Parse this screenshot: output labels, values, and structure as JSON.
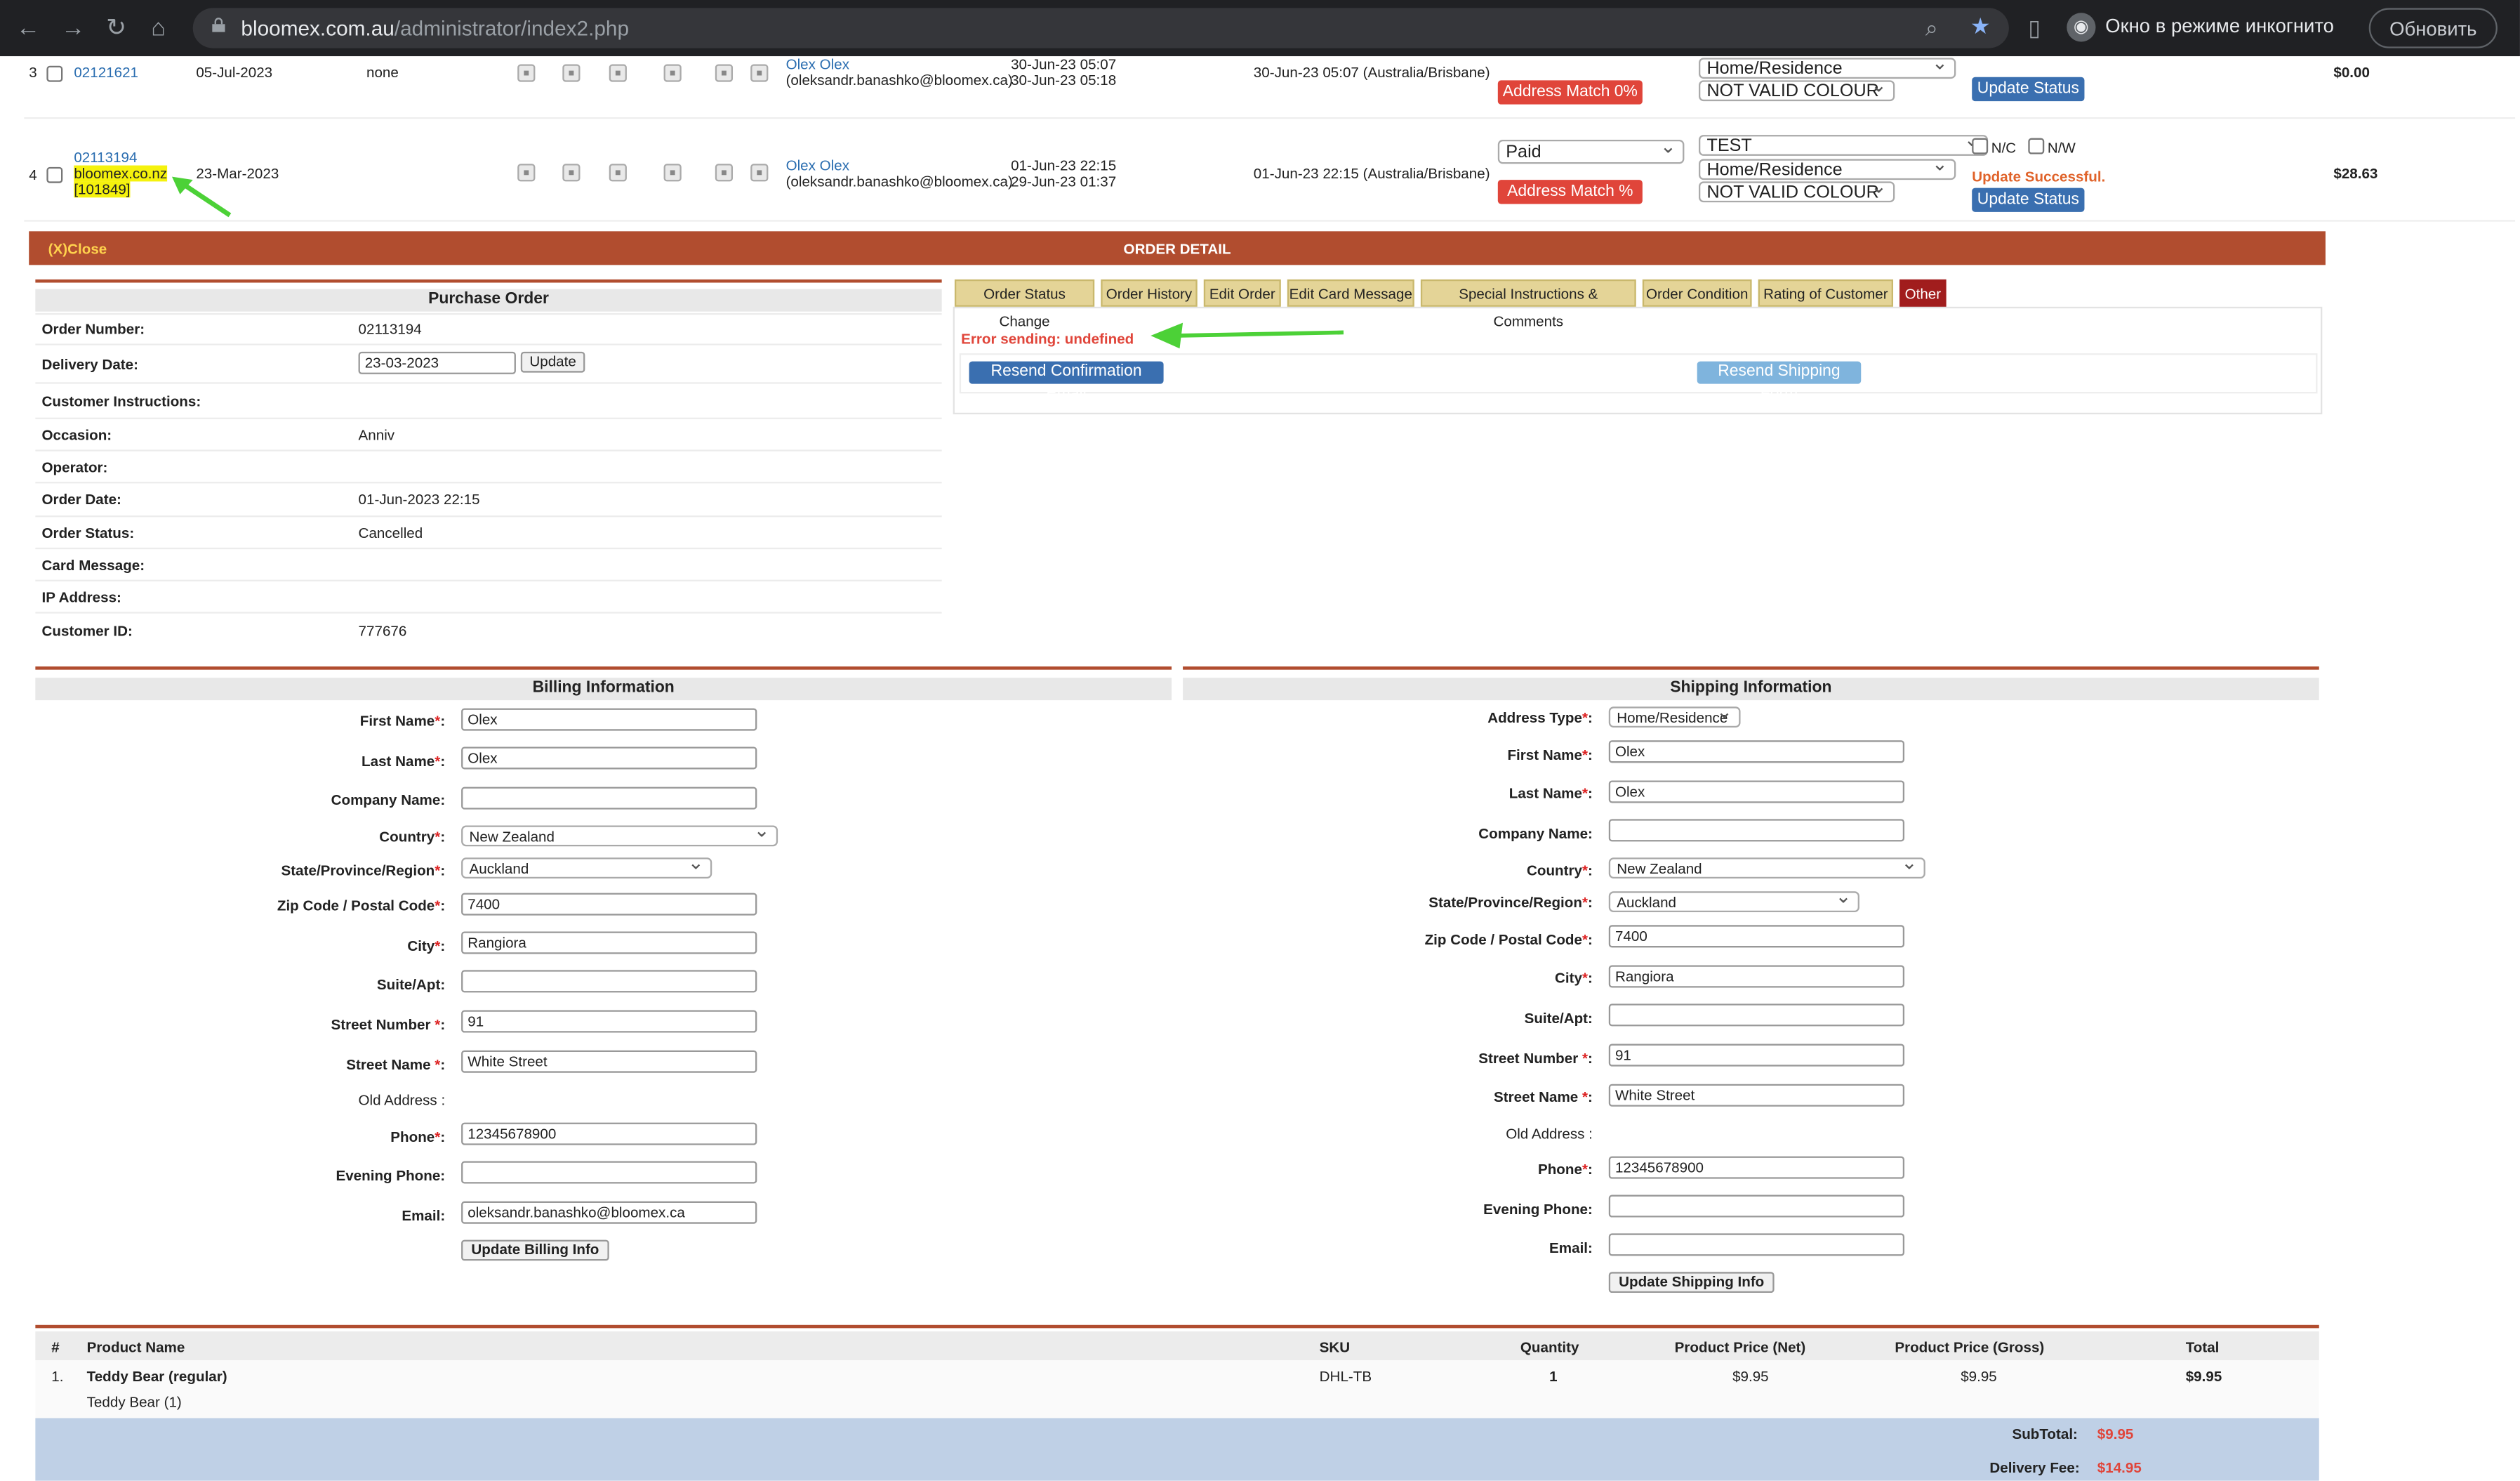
{
  "browser": {
    "url_domain": "bloomex.com.au",
    "url_path": "/administrator/index2.php",
    "incognito_label": "Окно в режиме инкогнито",
    "refresh_label": "Обновить"
  },
  "orders": [
    {
      "index": "3",
      "order_link": "02121621",
      "date": "05-Jul-2023",
      "status": "none",
      "customer_name": "Olex Olex",
      "customer_email": "(oleksandr.banashko@bloomex.ca)",
      "times_1": "30-Jun-23 05:07",
      "times_2": "30-Jun-23 05:18",
      "timestamp_tz": "30-Jun-23 05:07 (Australia/Brisbane)",
      "address_match": "Address Match 0%",
      "address_type": "Home/Residence",
      "colour": "NOT VALID COLOUR",
      "update_status": "Update Status",
      "total": "$0.00"
    },
    {
      "index": "4",
      "order_link": "02113194",
      "site": "bloomex.co.nz",
      "site_id": "[101849]",
      "date": "23-Mar-2023",
      "customer_name": "Olex Olex",
      "customer_email": "(oleksandr.banashko@bloomex.ca)",
      "times_1": "01-Jun-23 22:15",
      "times_2": "29-Jun-23 01:37",
      "timestamp_tz": "01-Jun-23 22:15 (Australia/Brisbane)",
      "payment": "Paid",
      "address_match": "Address Match %",
      "test_label": "TEST",
      "address_type": "Home/Residence",
      "colour": "NOT VALID COLOUR",
      "nc": "N/C",
      "nw": "N/W",
      "update_msg": "Update Successful.",
      "update_status": "Update Status",
      "total": "$28.63"
    }
  ],
  "order_detail": {
    "close": "(X)Close",
    "title": "ORDER DETAIL"
  },
  "purchase_order": {
    "title": "Purchase Order",
    "rows": [
      {
        "label": "Order Number:",
        "value": "02113194"
      },
      {
        "label": "Delivery Date:",
        "value": "23-03-2023"
      },
      {
        "label": "Customer Instructions:",
        "value": ""
      },
      {
        "label": "Occasion:",
        "value": "Anniv"
      },
      {
        "label": "Operator:",
        "value": ""
      },
      {
        "label": "Order Date:",
        "value": "01-Jun-2023 22:15"
      },
      {
        "label": "Order Status:",
        "value": "Cancelled"
      },
      {
        "label": "Card Message:",
        "value": ""
      },
      {
        "label": "IP Address:",
        "value": ""
      },
      {
        "label": "Customer ID:",
        "value": "777676"
      }
    ],
    "update_button": "Update"
  },
  "tabs": [
    "Order Status Change",
    "Order History",
    "Edit Order",
    "Edit Card Message",
    "Special Instructions & Comments",
    "Order Condition",
    "Rating of Customer",
    "Other"
  ],
  "other_tab": {
    "error": "Error sending: undefined",
    "resend_confirmation": "Resend Confirmation Email",
    "resend_shipping": "Resend Shipping Form"
  },
  "billing": {
    "title": "Billing Information",
    "labels": {
      "first_name": "First Name",
      "last_name": "Last Name",
      "company": "Company Name:",
      "country": "Country",
      "state": "State/Province/Region",
      "zip": "Zip Code / Postal Code",
      "city": "City",
      "suite": "Suite/Apt:",
      "street_number": "Street Number ",
      "street_name": "Street Name ",
      "old_address": "Old Address :",
      "phone": "Phone",
      "evening_phone": "Evening Phone:",
      "email": "Email:"
    },
    "values": {
      "first_name": "Olex",
      "last_name": "Olex",
      "company": "",
      "country": "New Zealand",
      "state": "Auckland",
      "zip": "7400",
      "city": "Rangiora",
      "suite": "",
      "street_number": "91",
      "street_name": "White Street",
      "phone": "12345678900",
      "evening_phone": "",
      "email": "oleksandr.banashko@bloomex.ca"
    },
    "update_button": "Update Billing Info"
  },
  "shipping": {
    "title": "Shipping Information",
    "labels": {
      "address_type": "Address Type",
      "first_name": "First Name",
      "last_name": "Last Name",
      "company": "Company Name:",
      "country": "Country",
      "state": "State/Province/Region",
      "zip": "Zip Code / Postal Code",
      "city": "City",
      "suite": "Suite/Apt:",
      "street_number": "Street Number ",
      "street_name": "Street Name ",
      "old_address": "Old Address :",
      "phone": "Phone",
      "evening_phone": "Evening Phone:",
      "email": "Email:"
    },
    "values": {
      "address_type": "Home/Residence",
      "first_name": "Olex",
      "last_name": "Olex",
      "company": "",
      "country": "New Zealand",
      "state": "Auckland",
      "zip": "7400",
      "city": "Rangiora",
      "suite": "",
      "street_number": "91",
      "street_name": "White Street",
      "phone": "12345678900",
      "evening_phone": "",
      "email": ""
    },
    "update_button": "Update Shipping Info"
  },
  "products": {
    "headers": [
      "#",
      "Product Name",
      "SKU",
      "Quantity",
      "Product Price (Net)",
      "Product Price (Gross)",
      "Total"
    ],
    "rows": [
      {
        "num": "1.",
        "name": "Teddy Bear (regular)",
        "sub": "Teddy Bear (1)",
        "sku": "DHL-TB",
        "qty": "1",
        "net": "$9.95",
        "gross": "$9.95",
        "total": "$9.95"
      }
    ],
    "subtotal_label": "SubTotal:",
    "subtotal": "$9.95",
    "delivery_label": "Delivery Fee:",
    "delivery": "$14.95"
  },
  "colors": {
    "accent": "#b14d2f",
    "tab_bg": "#e4d497",
    "button_blue": "#3a6fb0",
    "error": "#e0453a",
    "green_arrow": "#4cd137"
  }
}
